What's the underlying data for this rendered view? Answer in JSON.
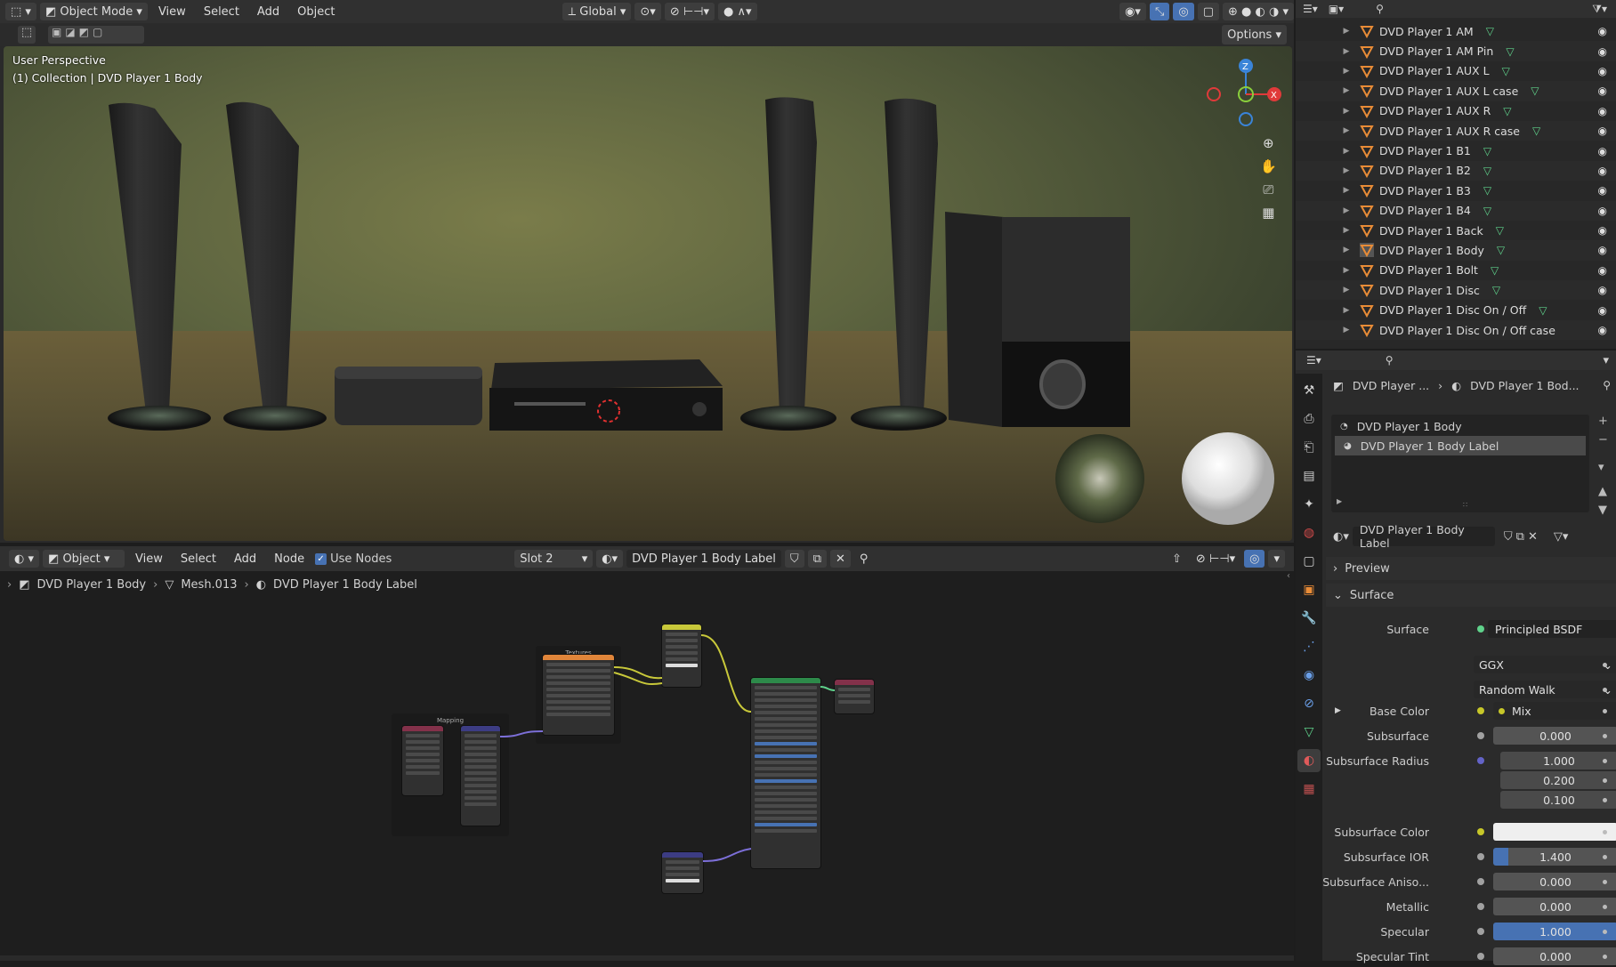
{
  "viewport": {
    "mode": "Object Mode",
    "menus": [
      "View",
      "Select",
      "Add",
      "Object"
    ],
    "orientation": "Global",
    "options_label": "Options",
    "perspective_label": "User Perspective",
    "collection_label": "(1) Collection | DVD Player 1 Body",
    "gizmo": {
      "z": "Z",
      "x": "X"
    }
  },
  "node_editor": {
    "editor_type": "Object",
    "menus": [
      "View",
      "Select",
      "Add",
      "Node"
    ],
    "use_nodes_label": "Use Nodes",
    "slot": "Slot 2",
    "material": "DVD Player 1 Body Label",
    "breadcrumb": [
      "DVD Player 1 Body",
      "Mesh.013",
      "DVD Player 1 Body Label"
    ],
    "frame_labels": {
      "mapping": "Mapping",
      "textures": "Textures"
    }
  },
  "outliner": {
    "items": [
      "DVD Player 1 AM",
      "DVD Player 1 AM Pin",
      "DVD Player 1 AUX L",
      "DVD Player 1 AUX L case",
      "DVD Player 1 AUX R",
      "DVD Player 1 AUX R case",
      "DVD Player 1 B1",
      "DVD Player 1 B2",
      "DVD Player 1 B3",
      "DVD Player 1 B4",
      "DVD Player 1 Back",
      "DVD Player 1 Body",
      "DVD Player 1 Bolt",
      "DVD Player 1 Disc",
      "DVD Player 1 Disc On / Off",
      "DVD Player 1 Disc On / Off case"
    ]
  },
  "properties": {
    "breadcrumb": [
      "DVD Player ...",
      "DVD Player 1 Bod..."
    ],
    "slots": [
      "DVD Player 1 Body",
      "DVD Player 1 Body Label"
    ],
    "material_name": "DVD Player 1 Body Label",
    "panels": {
      "preview": "Preview",
      "surface": "Surface"
    },
    "surface_label": "Surface",
    "surface_value": "Principled BSDF",
    "distribution": "GGX",
    "subsurface_method": "Random Walk",
    "fields": [
      {
        "label": "Base Color",
        "value": "Mix"
      },
      {
        "label": "Subsurface",
        "value": "0.000"
      },
      {
        "label": "Subsurface Radius",
        "value": "1.000"
      },
      {
        "label": "",
        "value": "0.200"
      },
      {
        "label": "",
        "value": "0.100"
      },
      {
        "label": "Subsurface Color",
        "value": ""
      },
      {
        "label": "Subsurface IOR",
        "value": "1.400"
      },
      {
        "label": "Subsurface Aniso...",
        "value": "0.000"
      },
      {
        "label": "Metallic",
        "value": "0.000"
      },
      {
        "label": "Specular",
        "value": "1.000"
      },
      {
        "label": "Specular Tint",
        "value": "0.000"
      }
    ]
  },
  "colors": {
    "accent": "#4772b3",
    "object_orange": "#e98c37",
    "mesh_green": "#5fd28b"
  }
}
